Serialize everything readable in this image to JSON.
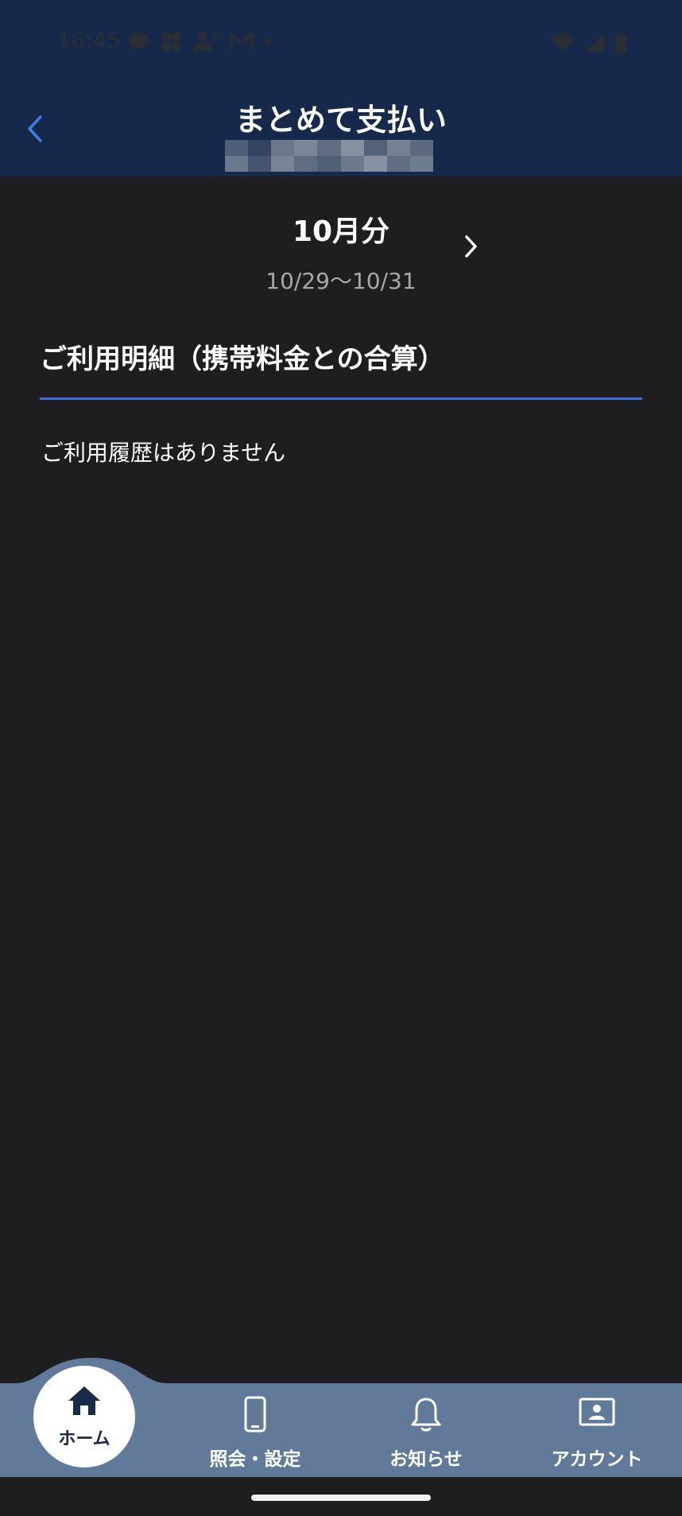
{
  "status_bar": {
    "time": "16:45"
  },
  "header": {
    "title": "まとめて支払い"
  },
  "period": {
    "title": "10月分",
    "range": "10/29〜10/31"
  },
  "section": {
    "title": "ご利用明細（携帯料金との合算）",
    "empty_message": "ご利用履歴はありません"
  },
  "bottom_nav": {
    "items": [
      {
        "label": "ホーム",
        "icon": "home-icon",
        "active": true
      },
      {
        "label": "照会・設定",
        "icon": "smartphone-icon",
        "active": false
      },
      {
        "label": "お知らせ",
        "icon": "bell-icon",
        "active": false
      },
      {
        "label": "アカウント",
        "icon": "account-card-icon",
        "active": false
      }
    ]
  },
  "colors": {
    "header_bg": "#17294a",
    "body_bg": "#1e1e20",
    "accent": "#3d6fd0",
    "nav_bg": "#627a99"
  }
}
